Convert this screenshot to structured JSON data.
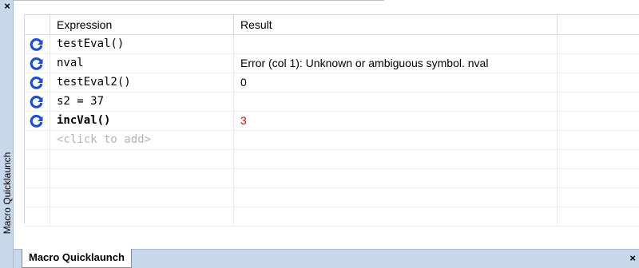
{
  "panel": {
    "title": "Macro Quicklaunch",
    "close_glyph": "×"
  },
  "grid": {
    "columns": [
      "Expression",
      "Result"
    ],
    "rows": [
      {
        "expression": "testEval()",
        "result": "",
        "bold": false,
        "result_color": "#000000"
      },
      {
        "expression": "nval",
        "result": "Error (col 1): Unknown or ambiguous symbol. nval",
        "bold": false,
        "result_color": "#000000"
      },
      {
        "expression": "testEval2()",
        "result": "0",
        "bold": false,
        "result_color": "#000000"
      },
      {
        "expression": "s2 = 37",
        "result": "",
        "bold": false,
        "result_color": "#000000"
      },
      {
        "expression": "incVal()",
        "result": "3",
        "bold": true,
        "result_color": "#e10000"
      }
    ],
    "add_placeholder": "<click to add>",
    "refresh_icon": "refresh-icon",
    "refresh_color": "#1f4fd1"
  },
  "tabs": {
    "active_label": "Macro Quicklaunch",
    "close_glyph": "×"
  }
}
